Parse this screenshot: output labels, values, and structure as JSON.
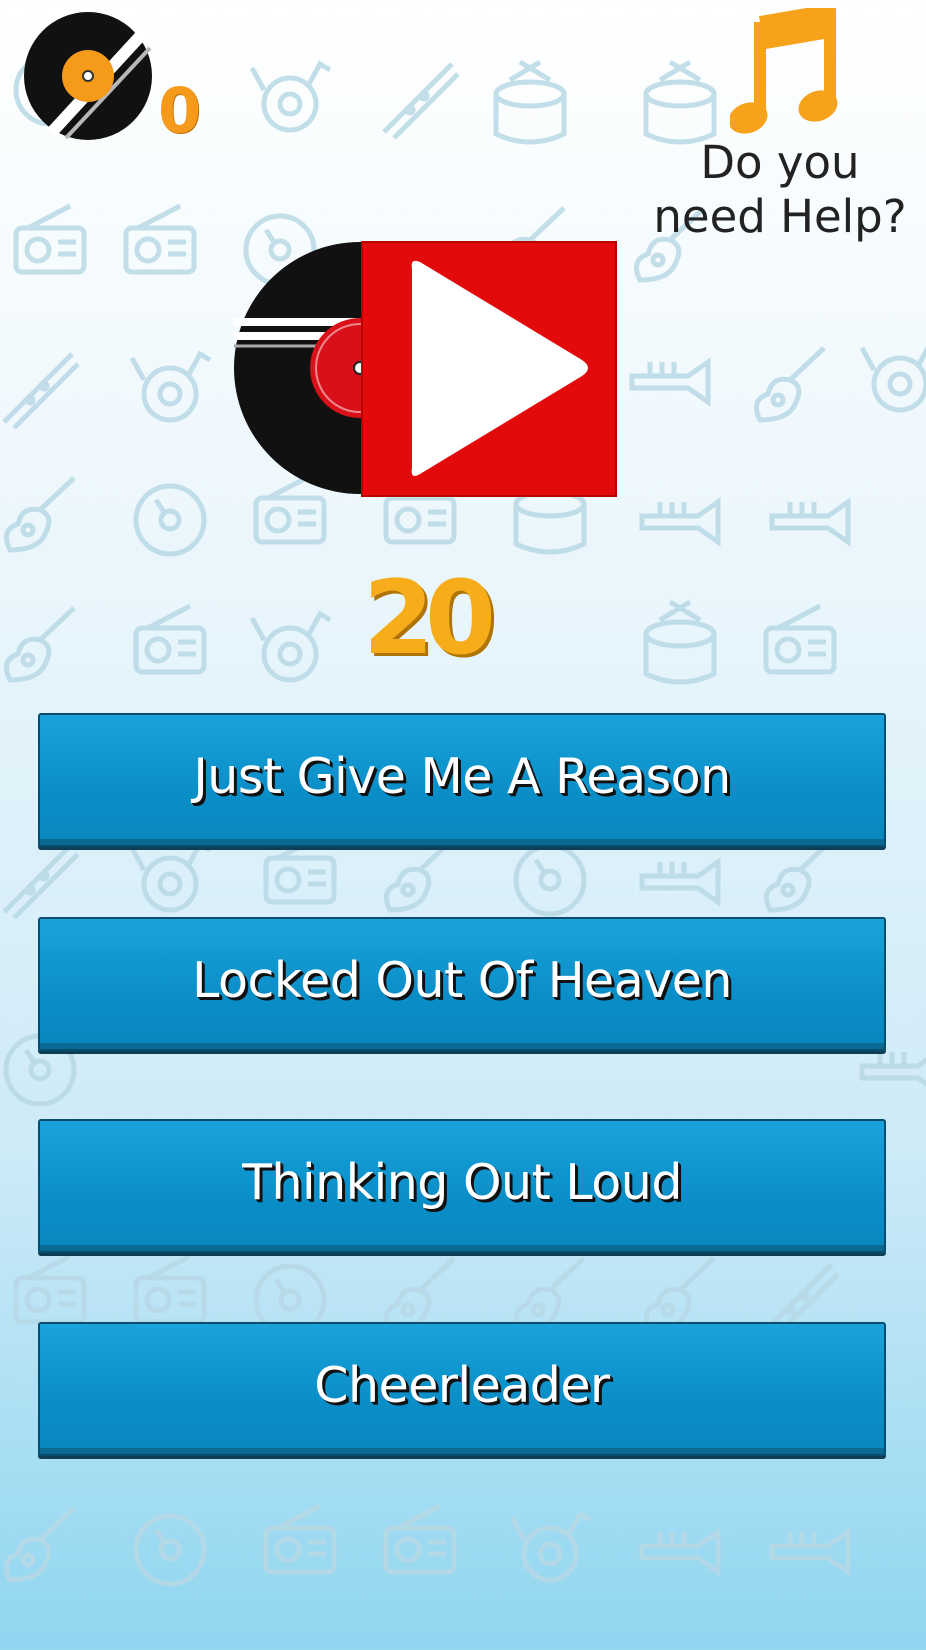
{
  "score": {
    "value": "0",
    "icon": "vinyl-record-icon"
  },
  "help": {
    "icon": "music-note-icon",
    "line1": "Do you",
    "line2": "need Help?"
  },
  "play": {
    "icon": "play-icon",
    "record_icon": "vinyl-record-icon"
  },
  "timer": {
    "value": "20"
  },
  "answers": [
    {
      "label": "Just Give Me A Reason"
    },
    {
      "label": "Locked Out Of Heaven"
    },
    {
      "label": "Thinking Out Loud"
    },
    {
      "label": "Cheerleader"
    }
  ],
  "colors": {
    "accent_orange": "#f59a1b",
    "timer_gold": "#f7ad1a",
    "button_blue": "#0a8ec8",
    "play_red": "#e00000"
  }
}
